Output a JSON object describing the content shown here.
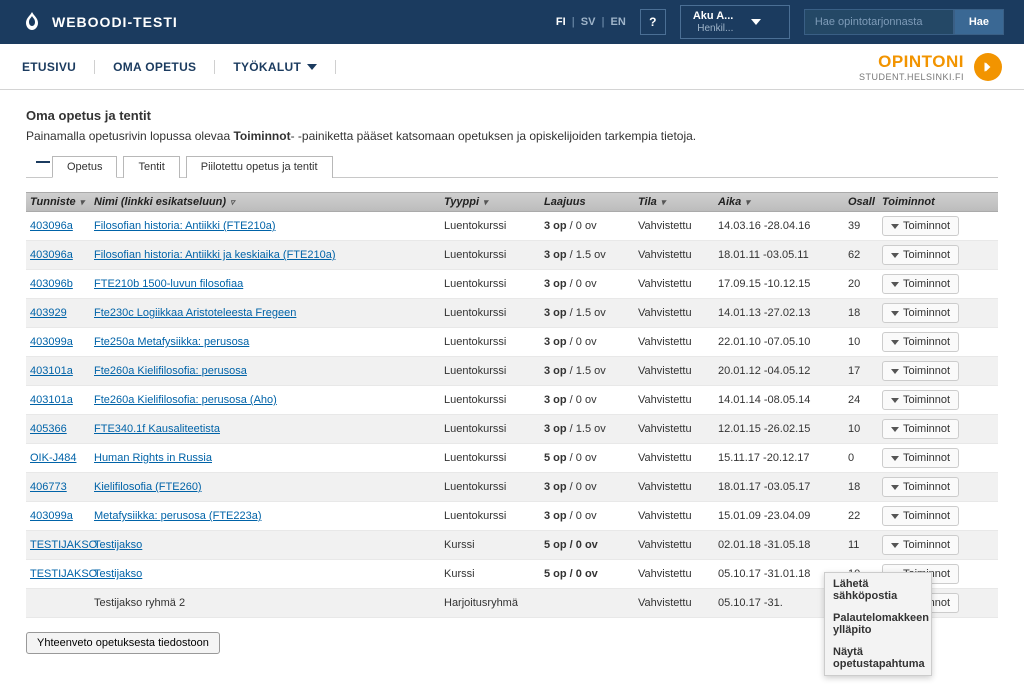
{
  "brand": "WEBOODI-TESTI",
  "langs": {
    "fi": "FI",
    "sv": "SV",
    "en": "EN"
  },
  "help": "?",
  "user": {
    "name": "Aku A...",
    "role": "Henkil..."
  },
  "search": {
    "placeholder": "Hae opintotarjonnasta",
    "button": "Hae"
  },
  "nav": {
    "home": "ETUSIVU",
    "own": "OMA OPETUS",
    "tools": "TYÖKALUT"
  },
  "opintoni": {
    "title": "OPINTONI",
    "sub": "STUDENT.HELSINKI.FI"
  },
  "page": {
    "title": "Oma opetus ja tentit",
    "desc1": "Painamalla opetusrivin lopussa olevaa ",
    "descBold": "Toiminnot",
    "desc2": "- -painiketta pääset katsomaan opetuksen ja opiskelijoiden tarkempia tietoja."
  },
  "tabs": {
    "opetus": "Opetus",
    "tentit": "Tentit",
    "hidden": "Piilotettu opetus ja tentit"
  },
  "headers": {
    "id": "Tunniste",
    "name": "Nimi (linkki esikatseluun)",
    "type": "Tyyppi",
    "ext": "Laajuus",
    "state": "Tila",
    "time": "Aika",
    "part": "Osall",
    "act": "Toiminnot"
  },
  "actionBtn": "Toiminnot",
  "rows": [
    {
      "id": "403096a",
      "name": "Filosofian historia: Antiikki (FTE210a) ",
      "type": "Luentokurssi",
      "extB": "3 op",
      "extR": " / 0 ov",
      "state": "Vahvistettu",
      "time": "14.03.16 -28.04.16",
      "part": "39"
    },
    {
      "id": "403096a",
      "name": "Filosofian historia: Antiikki ja keskiaika (FTE210a) ",
      "type": "Luentokurssi",
      "extB": "3 op",
      "extR": " / 1.5 ov",
      "state": "Vahvistettu",
      "time": "18.01.11 -03.05.11",
      "part": "62"
    },
    {
      "id": "403096b",
      "name": "FTE210b 1500-luvun filosofiaa  ",
      "type": "Luentokurssi",
      "extB": "3 op",
      "extR": " / 0 ov",
      "state": "Vahvistettu",
      "time": "17.09.15 -10.12.15",
      "part": "20"
    },
    {
      "id": "403929",
      "name": "Fte230c Logiikkaa Aristoteleesta Fregeen ",
      "type": "Luentokurssi",
      "extB": "3 op",
      "extR": " / 1.5 ov",
      "state": "Vahvistettu",
      "time": "14.01.13 -27.02.13",
      "part": "18"
    },
    {
      "id": "403099a",
      "name": "Fte250a Metafysiikka: perusosa ",
      "type": "Luentokurssi",
      "extB": "3 op",
      "extR": " / 0 ov",
      "state": "Vahvistettu",
      "time": "22.01.10 -07.05.10",
      "part": "10"
    },
    {
      "id": "403101a",
      "name": "Fte260a Kielifilosofia: perusosa ",
      "type": "Luentokurssi",
      "extB": "3 op",
      "extR": " / 1.5 ov",
      "state": "Vahvistettu",
      "time": "20.01.12 -04.05.12",
      "part": "17"
    },
    {
      "id": "403101a",
      "name": "Fte260a Kielifilosofia: perusosa (Aho) ",
      "type": "Luentokurssi",
      "extB": "3 op",
      "extR": " / 0 ov",
      "state": "Vahvistettu",
      "time": "14.01.14 -08.05.14",
      "part": "24"
    },
    {
      "id": "405366",
      "name": "FTE340.1f Kausaliteetista ",
      "type": "Luentokurssi",
      "extB": "3 op",
      "extR": " / 1.5 ov",
      "state": "Vahvistettu",
      "time": "12.01.15 -26.02.15",
      "part": "10"
    },
    {
      "id": "OIK-J484",
      "name": "Human Rights in Russia ",
      "type": "Luentokurssi",
      "extB": "5 op",
      "extR": " / 0 ov",
      "state": "Vahvistettu",
      "time": "15.11.17 -20.12.17",
      "part": "0"
    },
    {
      "id": "406773",
      "name": "Kielifilosofia (FTE260) ",
      "type": "Luentokurssi",
      "extB": "3 op",
      "extR": " / 0 ov",
      "state": "Vahvistettu",
      "time": "18.01.17 -03.05.17",
      "part": "18"
    },
    {
      "id": "403099a",
      "name": "Metafysiikka: perusosa (FTE223a) ",
      "type": "Luentokurssi",
      "extB": "3 op",
      "extR": " / 0 ov",
      "state": "Vahvistettu",
      "time": "15.01.09 -23.04.09",
      "part": "22"
    },
    {
      "id": "TESTIJAKSO",
      "name": "Testijakso ",
      "type": "Kurssi",
      "extB": "5 op / 0 ov",
      "extR": "",
      "state": "Vahvistettu",
      "time": "02.01.18 -31.05.18",
      "part": "11"
    },
    {
      "id": "TESTIJAKSO",
      "name": "Testijakso ",
      "type": "Kurssi",
      "extB": "5 op / 0 ov",
      "extR": "",
      "state": "Vahvistettu",
      "time": "05.10.17 -31.01.18",
      "part": "10"
    },
    {
      "id": "",
      "name": "Testijakso ryhmä 2",
      "nolink": true,
      "type": "Harjoitusryhmä",
      "extB": "",
      "extR": "",
      "state": "Vahvistettu",
      "time": "05.10.17 -31.",
      "part": ""
    }
  ],
  "summaryBtn": "Yhteenveto opetuksesta tiedostoon",
  "dropdown": {
    "email": "Lähetä sähköpostia",
    "feedback": "Palautelomakkeen ylläpito",
    "show": "Näytä opetustapahtuma"
  }
}
